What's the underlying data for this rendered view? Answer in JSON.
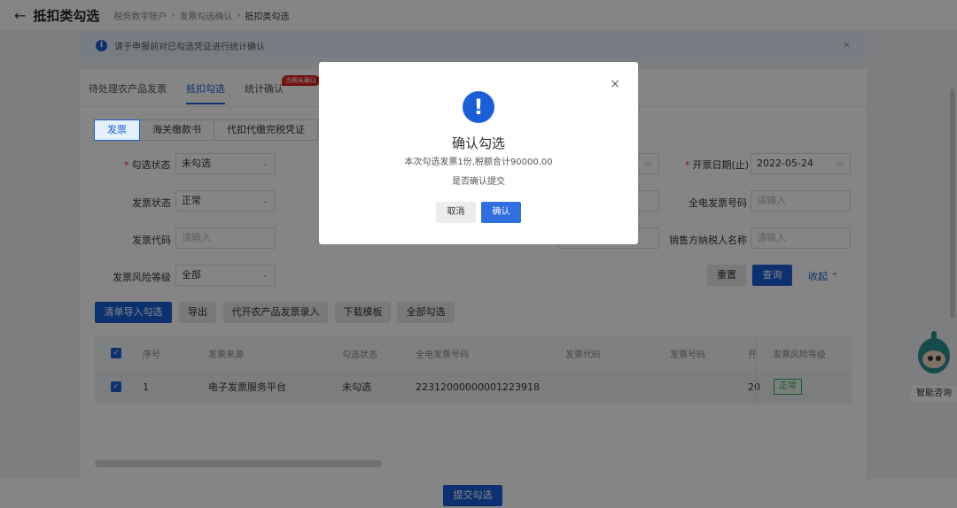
{
  "header": {
    "back_icon": "arrow-left-icon",
    "title": "抵扣类勾选",
    "breadcrumb": [
      "税务数字账户",
      "发票勾选确认",
      "抵扣类勾选"
    ]
  },
  "notice": {
    "text": "请于申报前对已勾选凭证进行统计确认",
    "close": "×"
  },
  "tabs": [
    {
      "label": "待处理农产品发票"
    },
    {
      "label": "抵扣勾选"
    },
    {
      "label": "统计确认",
      "badge": "当期未确认"
    }
  ],
  "type_tabs": [
    "发票",
    "海关缴款书",
    "代扣代缴完税凭证"
  ],
  "filters": {
    "check_status": {
      "label": "勾选状态",
      "value": "未勾选"
    },
    "invoice_status": {
      "label": "发票状态",
      "value": "正常"
    },
    "invoice_code": {
      "label": "发票代码",
      "placeholder": "请输入"
    },
    "risk_level": {
      "label": "发票风险等级",
      "value": "全部"
    },
    "issue_date_end": {
      "label": "开票日期(止)",
      "value": "2022-05-24"
    },
    "full_invoice_no": {
      "label": "全电发票号码",
      "placeholder": "请输入"
    },
    "seller_name": {
      "label": "销售方纳税人名称",
      "placeholder": "请输入"
    },
    "reset": "重置",
    "search": "查询",
    "collapse": "收起"
  },
  "actions": [
    "清单导入勾选",
    "导出",
    "代开农产品发票录入",
    "下载模板",
    "全部勾选"
  ],
  "table": {
    "headers": [
      "序号",
      "发票来源",
      "勾选状态",
      "全电发票号码",
      "发票代码",
      "发票号码",
      "开",
      "发票风险等级"
    ],
    "rows": [
      {
        "index": "1",
        "source": "电子发票服务平台",
        "status": "未勾选",
        "full_no": "22312000000001223918",
        "code": "",
        "number": "",
        "date": "20",
        "risk": "正常"
      }
    ]
  },
  "submit": "提交勾选",
  "assistant": {
    "label": "智能咨询"
  },
  "modal": {
    "title": "确认勾选",
    "message": "本次勾选发票1份,税额合计90000.00",
    "question": "是否确认提交",
    "cancel": "取消",
    "confirm": "确认",
    "close": "×"
  },
  "colors": {
    "primary": "#1a5fd6",
    "danger": "#d9241a",
    "success": "#3aa55c"
  }
}
